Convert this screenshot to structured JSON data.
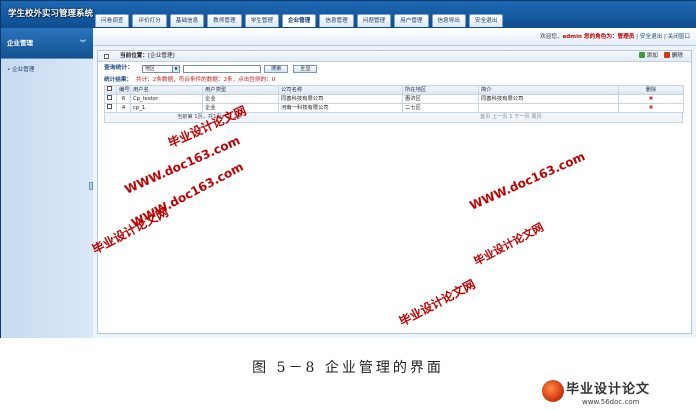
{
  "app": {
    "logo": "学生校外实习管理系统"
  },
  "nav": {
    "tabs": [
      "问卷调查",
      "评价打分",
      "基础信息",
      "教师管理",
      "学生管理",
      "企业管理",
      "信息管理",
      "问题管理",
      "用户管理",
      "信息导出",
      "安全退出"
    ],
    "active_index": 5
  },
  "sidebar": {
    "title": "企业管理",
    "items": [
      "• 企业管理"
    ]
  },
  "userbar": {
    "welcome": "欢迎您，",
    "user": "admin",
    "role_label": " 您的角色为：",
    "role": "管理员",
    "logout": "| 安全退出",
    "close": "| 关闭窗口"
  },
  "content": {
    "location_label": "当前位置：",
    "location": "[企业管理]",
    "add_label": "添加",
    "delete_label": "删除",
    "search_label": "查询统计：",
    "select_value": "地区",
    "query_value": "",
    "search_button": "搜索",
    "all_button": "全显",
    "stats_label": "统计结果：",
    "stats_text": "共计：2条数据，符合条件的数据：2条，点击性例的：0"
  },
  "table": {
    "headers": [
      "",
      "编号",
      "用户名",
      "用户类型",
      "公司名称",
      "所在地区",
      "简介",
      "删除"
    ],
    "rows": [
      {
        "id": "6",
        "username": "Cp_tester",
        "type": "企业",
        "company": "同善科技有限公司",
        "area": "惠济区",
        "intro": "同善科技有限公司",
        "del": "✖"
      },
      {
        "id": "4",
        "username": "cp_1",
        "type": "企业",
        "company": "河南一科技有限公司",
        "area": "二七区",
        "intro": "",
        "del": "✖"
      }
    ]
  },
  "pager": {
    "left": "当前第 1页，共1页，共 2条",
    "right": "首页 上一页 1 下一页 尾页"
  },
  "caption": "图 5－8  企业管理的界面",
  "watermarks": {
    "site": "毕业设计论文网",
    "url": "WWW.doc163.com"
  },
  "corner": {
    "title": "毕业设计论文",
    "url": "www.56doc.com"
  },
  "colors": {
    "header_blue": "#1e69b4",
    "warning_red": "#d01818",
    "watermark_red": "#c10000"
  }
}
